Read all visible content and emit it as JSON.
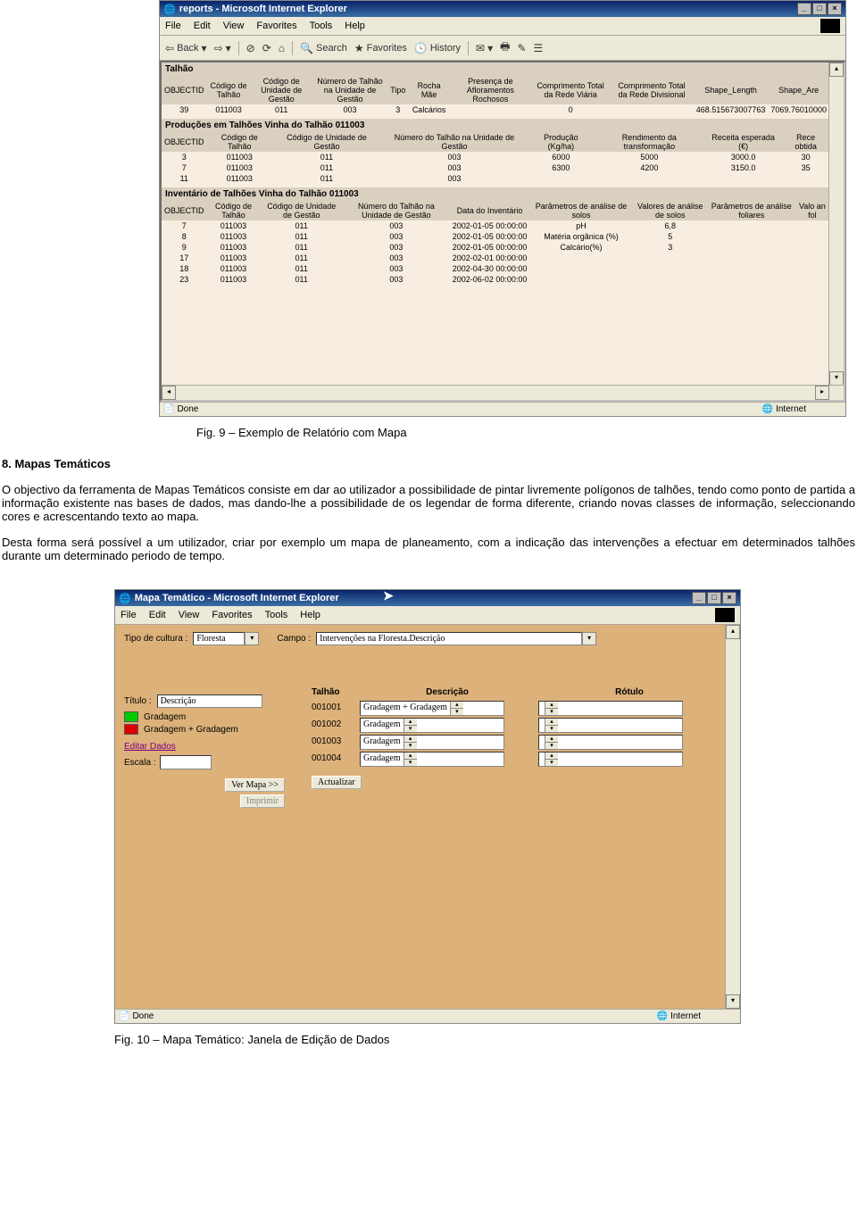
{
  "fig1": {
    "window_title": "reports - Microsoft Internet Explorer",
    "menu": [
      "File",
      "Edit",
      "View",
      "Favorites",
      "Tools",
      "Help"
    ],
    "toolbar": {
      "back": "Back",
      "search": "Search",
      "favorites": "Favorites",
      "history": "History"
    },
    "section1_title": "Talhão",
    "section1_cols": [
      "OBJECTID",
      "Código de Talhão",
      "Código de Unidade de Gestão",
      "Número de Talhão na Unidade de Gestão",
      "Tipo",
      "Rocha Mãe",
      "Presença de Afloramentos Rochosos",
      "Comprimento Total da Rede Viária",
      "Comprimento Total da Rede Divisional",
      "Shape_Length",
      "Shape_Are"
    ],
    "section1_row": [
      "39",
      "011003",
      "011",
      "003",
      "3",
      "Calcários",
      "",
      "0",
      "",
      "468.515673007763",
      "7069.76010000"
    ],
    "section2_title": "Produções em Talhões Vinha do Talhão 011003",
    "section2_cols": [
      "OBJECTID",
      "Código de Talhão",
      "Código de Unidade de Gestão",
      "Número do Talhão na Unidade de Gestão",
      "Produção (Kg/ha)",
      "Rendimento da transformação",
      "Receita esperada (€)",
      "Rece obtida"
    ],
    "section2_rows": [
      [
        "3",
        "011003",
        "011",
        "003",
        "6000",
        "5000",
        "3000.0",
        "30"
      ],
      [
        "7",
        "011003",
        "011",
        "003",
        "6300",
        "4200",
        "3150.0",
        "35"
      ],
      [
        "11",
        "011003",
        "011",
        "003",
        "",
        "",
        "",
        ""
      ]
    ],
    "section3_title": "Inventário de Talhões Vinha do Talhão 011003",
    "section3_cols": [
      "OBJECTID",
      "Código de Talhão",
      "Código de Unidade de Gestão",
      "Número do Talhão na Unidade de Gestão",
      "Data do Inventário",
      "Parâmetros de análise de solos",
      "Valores de análise de solos",
      "Parâmetros de análise foliares",
      "Valo an fol"
    ],
    "section3_rows": [
      [
        "7",
        "011003",
        "011",
        "003",
        "2002-01-05 00:00:00",
        "pH",
        "6,8",
        "",
        ""
      ],
      [
        "8",
        "011003",
        "011",
        "003",
        "2002-01-05 00:00:00",
        "Matéria orgânica (%)",
        "5",
        "",
        ""
      ],
      [
        "9",
        "011003",
        "011",
        "003",
        "2002-01-05 00:00:00",
        "Calcário(%)",
        "3",
        "",
        ""
      ],
      [
        "17",
        "011003",
        "011",
        "003",
        "2002-02-01 00:00:00",
        "",
        "",
        "",
        ""
      ],
      [
        "18",
        "011003",
        "011",
        "003",
        "2002-04-30 00:00:00",
        "",
        "",
        "",
        ""
      ],
      [
        "23",
        "011003",
        "011",
        "003",
        "2002-06-02 00:00:00",
        "",
        "",
        "",
        ""
      ]
    ],
    "status_done": "Done",
    "status_zone": "Internet",
    "caption": "Fig. 9 – Exemplo de Relatório com Mapa"
  },
  "section_heading": "8. Mapas Temáticos",
  "para1": "O objectivo da ferramenta de Mapas Temáticos consiste em dar ao utilizador a possibilidade de pintar livremente polígonos de talhões, tendo como ponto de partida a informação existente nas bases de dados, mas dando-lhe a possibilidade de os legendar de forma diferente, criando novas classes de informação, seleccionando cores e acrescentando texto ao mapa.",
  "para2": "Desta forma será possível a um utilizador, criar por exemplo um mapa de planeamento, com a indicação das intervenções a efectuar em determinados talhões durante um determinado periodo de tempo.",
  "fig2": {
    "window_title": "Mapa Temático - Microsoft Internet Explorer",
    "menu": [
      "File",
      "Edit",
      "View",
      "Favorites",
      "Tools",
      "Help"
    ],
    "labels": {
      "tipo_cultura": "Tipo de cultura :",
      "campo": "Campo :",
      "titulo": "Título :",
      "escala": "Escala :"
    },
    "tipo_cultura_value": "Floresta",
    "campo_value": "Intervenções na Floresta.Descrição",
    "titulo_value": "Descrição",
    "legend": [
      "Gradagem",
      "Gradagem + Gradagem"
    ],
    "editar_dados": "Editar Dados",
    "ver_mapa": "Ver Mapa >>",
    "imprimir": "Imprimir",
    "grid_headers": [
      "Talhão",
      "Descrição",
      "Rótulo"
    ],
    "grid_rows": [
      {
        "talhao": "001001",
        "desc": "Gradagem + Gradagem",
        "rotulo": ""
      },
      {
        "talhao": "001002",
        "desc": "Gradagem",
        "rotulo": ""
      },
      {
        "talhao": "001003",
        "desc": "Gradagem",
        "rotulo": ""
      },
      {
        "talhao": "001004",
        "desc": "Gradagem",
        "rotulo": ""
      }
    ],
    "actualizar": "Actualizar",
    "status_done": "Done",
    "status_zone": "Internet",
    "caption": "Fig. 10 – Mapa Temático: Janela de Edição de Dados"
  }
}
